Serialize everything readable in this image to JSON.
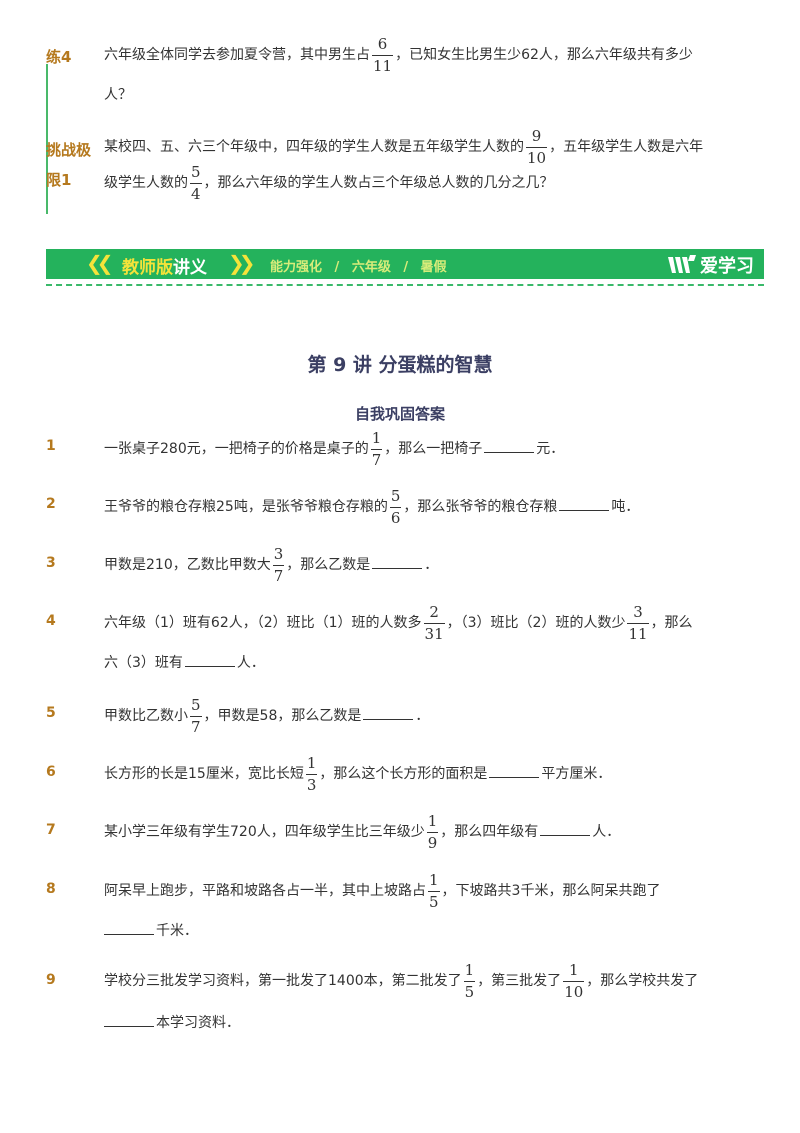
{
  "exercises": [
    {
      "label": "练4",
      "line1_a": "六年级全体同学去参加夏令营，其中男生占",
      "line1_frac": {
        "n": "6",
        "d": "11"
      },
      "line1_b": "，已知女生比男生少62人，那么六年级共有多少",
      "line2": "人？"
    },
    {
      "label_line1": "挑战极",
      "label_line2": "限1",
      "line1_a": "某校四、五、六三个年级中，四年级的学生人数是五年级学生人数的",
      "line1_frac": {
        "n": "9",
        "d": "10"
      },
      "line1_b": "，五年级学生人数是六年",
      "line2_a": "级学生人数的",
      "line2_frac": {
        "n": "5",
        "d": "4"
      },
      "line2_b": "，那么六年级的学生人数占三个年级总人数的几分之几？"
    }
  ],
  "banner": {
    "title_a": "教师版",
    "title_b": "讲义",
    "crumbs": [
      "能力强化",
      "六年级",
      "暑假"
    ],
    "sep": "/",
    "logo": "爱学习",
    "colors": {
      "bg": "#24b25c",
      "title_a": "#f5e33a",
      "crumb": "#d8ec7a"
    }
  },
  "lesson_title": "第 9 讲  分蛋糕的智慧",
  "section_title": "自我巩固答案",
  "problems": [
    {
      "num": "1",
      "a": "一张桌子280元，一把椅子的价格是桌子的",
      "frac": {
        "n": "1",
        "d": "7"
      },
      "b": "，那么一把椅子",
      "c": "元．"
    },
    {
      "num": "2",
      "a": "王爷爷的粮仓存粮25吨，是张爷爷粮仓存粮的",
      "frac": {
        "n": "5",
        "d": "6"
      },
      "b": "，那么张爷爷的粮仓存粮",
      "c": "吨．"
    },
    {
      "num": "3",
      "a": "甲数是210，乙数比甲数大",
      "frac": {
        "n": "3",
        "d": "7"
      },
      "b": "，那么乙数是",
      "c": "．"
    },
    {
      "num": "4",
      "a": "六年级（1）班有62人，（2）班比（1）班的人数多",
      "frac": {
        "n": "2",
        "d": "31"
      },
      "b": "，（3）班比（2）班的人数少",
      "frac2": {
        "n": "3",
        "d": "11"
      },
      "b2": "，那么",
      "line2_a": "六（3）班有",
      "line2_b": "人．"
    },
    {
      "num": "5",
      "a": "甲数比乙数小",
      "frac": {
        "n": "5",
        "d": "7"
      },
      "b": "，甲数是58，那么乙数是",
      "c": "．"
    },
    {
      "num": "6",
      "a": "长方形的长是15厘米，宽比长短",
      "frac": {
        "n": "1",
        "d": "3"
      },
      "b": "，那么这个长方形的面积是",
      "c": "平方厘米．"
    },
    {
      "num": "7",
      "a": "某小学三年级有学生720人，四年级学生比三年级少",
      "frac": {
        "n": "1",
        "d": "9"
      },
      "b": "，那么四年级有",
      "c": "人．"
    },
    {
      "num": "8",
      "a": "阿呆早上跑步，平路和坡路各占一半，其中上坡路占",
      "frac": {
        "n": "1",
        "d": "5"
      },
      "b": "，下坡路共3千米，那么阿呆共跑了",
      "line2": "千米．"
    },
    {
      "num": "9",
      "a": "学校分三批发学习资料，第一批发了1400本，第二批发了",
      "frac": {
        "n": "1",
        "d": "5"
      },
      "b": "，第三批发了",
      "frac2": {
        "n": "1",
        "d": "10"
      },
      "b2": "，那么学校共发了",
      "line2": "本学习资料．"
    }
  ]
}
